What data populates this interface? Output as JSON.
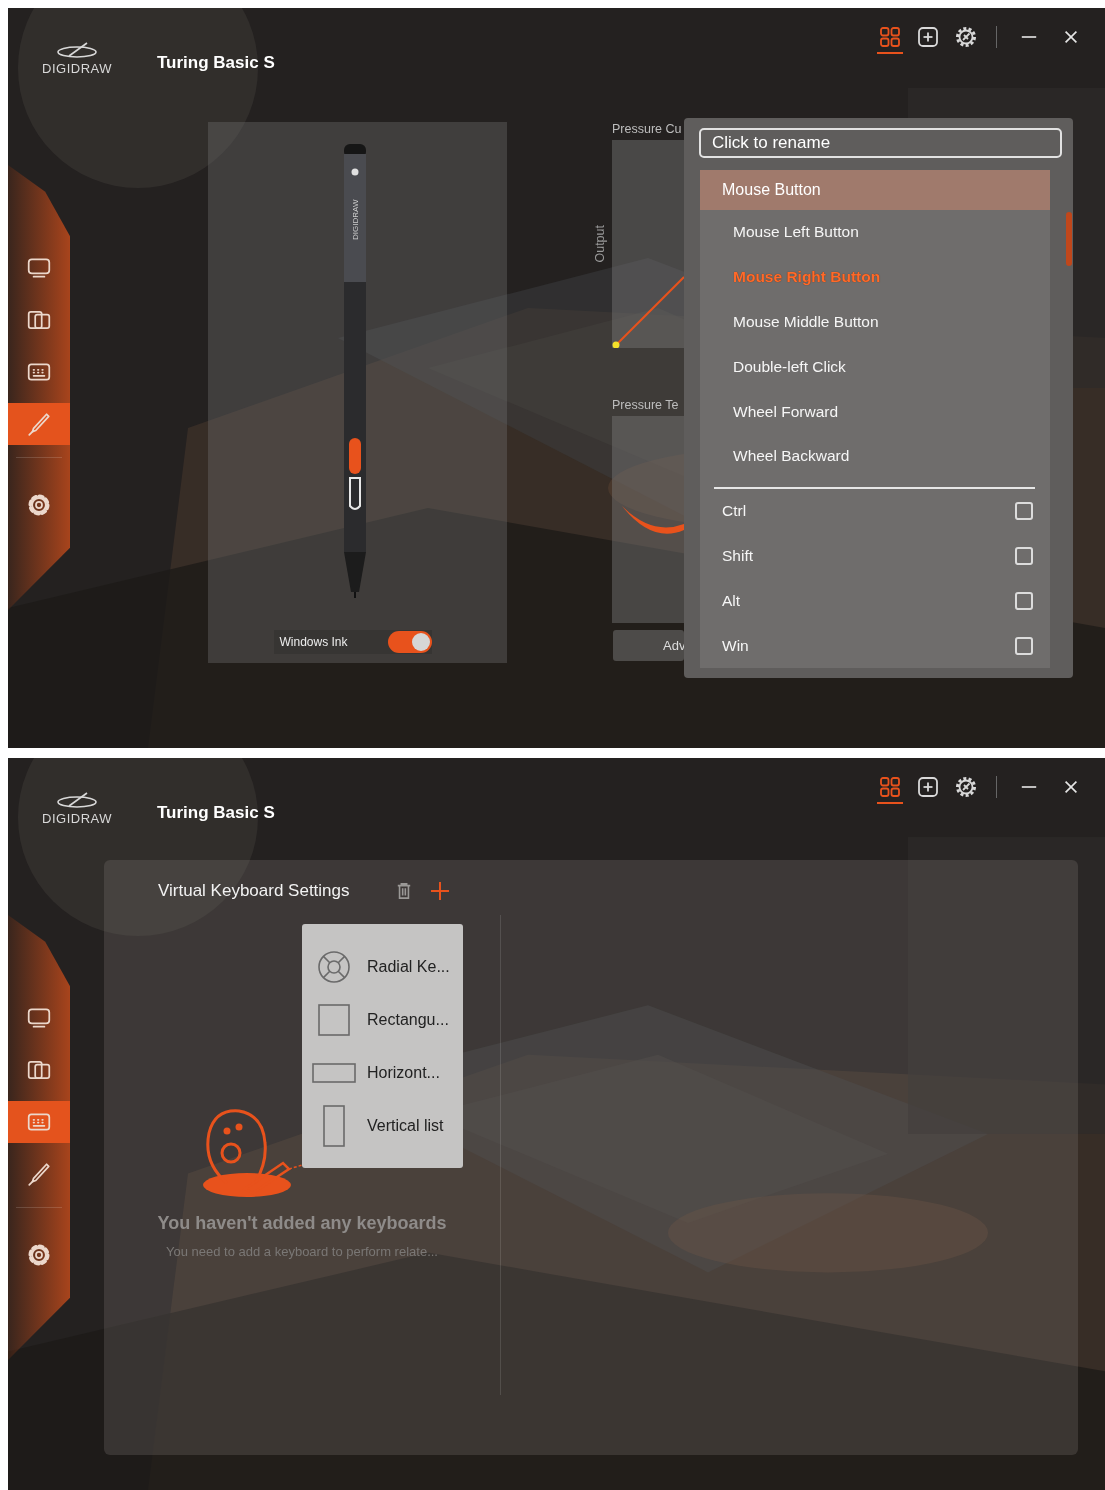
{
  "windows": [
    {
      "kind": "pen_settings",
      "logo": "DIGIDRAW",
      "title": "Turing Basic S",
      "tabs": [
        {
          "kind": "grid",
          "selected": true
        },
        {
          "kind": "add",
          "selected": false
        },
        {
          "kind": "badge",
          "selected": false
        }
      ],
      "window_controls": [
        {
          "kind": "minimize"
        },
        {
          "kind": "close"
        }
      ],
      "sidebar": [
        {
          "kind": "display",
          "selected": false
        },
        {
          "kind": "screens",
          "selected": false
        },
        {
          "kind": "keyboard",
          "selected": false
        },
        {
          "kind": "pen",
          "selected": true
        },
        {
          "kind": "settings",
          "selected": false
        }
      ],
      "pen_panel": {
        "pen_label": "DIGIDRAW",
        "windows_ink": {
          "label": "Windows Ink",
          "on": true
        }
      },
      "pressure": {
        "curve_title": "Pressure Cu",
        "axis_label": "Output",
        "test_title": "Pressure Te",
        "advanced_button": "Adv"
      },
      "dropdown": {
        "rename_placeholder": "Click to rename",
        "group": "Mouse Button",
        "options": [
          {
            "label": "Mouse Left Button",
            "selected": false
          },
          {
            "label": "Mouse Right Button",
            "selected": true
          },
          {
            "label": "Mouse Middle Button",
            "selected": false
          },
          {
            "label": "Double-left Click",
            "selected": false
          },
          {
            "label": "Wheel Forward",
            "selected": false
          },
          {
            "label": "Wheel Backward",
            "selected": false
          }
        ],
        "modifiers": [
          {
            "label": "Ctrl",
            "checked": false
          },
          {
            "label": "Shift",
            "checked": false
          },
          {
            "label": "Alt",
            "checked": false
          },
          {
            "label": "Win",
            "checked": false
          }
        ]
      }
    },
    {
      "kind": "keyboard_settings",
      "logo": "DIGIDRAW",
      "title": "Turing Basic S",
      "tabs": [
        {
          "kind": "grid",
          "selected": true
        },
        {
          "kind": "add",
          "selected": false
        },
        {
          "kind": "badge",
          "selected": false
        }
      ],
      "window_controls": [
        {
          "kind": "minimize"
        },
        {
          "kind": "close"
        }
      ],
      "sidebar": [
        {
          "kind": "display",
          "selected": false
        },
        {
          "kind": "screens",
          "selected": false
        },
        {
          "kind": "keyboard",
          "selected": true
        },
        {
          "kind": "pen",
          "selected": false
        },
        {
          "kind": "settings",
          "selected": false
        }
      ],
      "keyboard_panel": {
        "title": "Virtual Keyboard Settings",
        "menu": [
          {
            "kind": "radial",
            "label": "Radial Ke..."
          },
          {
            "kind": "rectangular",
            "label": "Rectangu..."
          },
          {
            "kind": "horizontal",
            "label": "Horizont..."
          },
          {
            "kind": "vertical",
            "label": "Vertical list"
          }
        ],
        "empty_title": "You haven't added any keyboards",
        "empty_text": "You need to add a keyboard to perform relate..."
      }
    }
  ]
}
